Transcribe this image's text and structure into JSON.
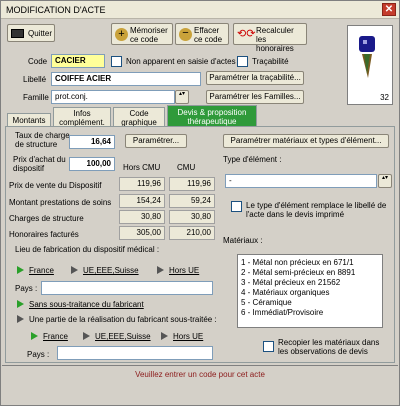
{
  "window": {
    "title": "MODIFICATION D'ACTE"
  },
  "toolbar": {
    "quit": "Quitter",
    "memorize": "Mémoriser ce code",
    "erase": "Effacer ce code",
    "recalc": "Recalculer les honoraires"
  },
  "preview": {
    "number": "32"
  },
  "form": {
    "code_label": "Code",
    "code_value": "CACIER",
    "non_apparent": "Non apparent en saisie d'actes",
    "tracabilite": "Traçabilité",
    "libelle_label": "Libellé",
    "libelle_value": "COIFFE ACIER",
    "param_tracabilite": "Paramétrer la traçabilité...",
    "famille_label": "Famille",
    "famille_value": "prot.conj.",
    "param_familles": "Paramétrer les Familles..."
  },
  "tabs": [
    {
      "label": "Montants"
    },
    {
      "label": "Infos complément."
    },
    {
      "label": "Code graphique"
    },
    {
      "label": "Devis & proposition thérapeutique"
    }
  ],
  "left": {
    "taux_label": "Taux de charge de structure",
    "taux_value": "16,64",
    "param_btn": "Paramétrer...",
    "prix_achat_label": "Prix d'achat du dispositif",
    "prix_achat_value": "100,00",
    "col_hors": "Hors CMU",
    "col_cmu": "CMU",
    "rows": [
      {
        "label": "Prix de vente du Dispositif",
        "hors": "119,96",
        "cmu": "119,96"
      },
      {
        "label": "Montant prestations de soins",
        "hors": "154,24",
        "cmu": "59,24"
      },
      {
        "label": "Charges de structure",
        "hors": "30,80",
        "cmu": "30,80"
      },
      {
        "label": "Honoraires facturés",
        "hors": "305,00",
        "cmu": "210,00"
      }
    ],
    "lieu_label": "Lieu de fabrication du dispositif médical :",
    "france": "France",
    "ue": "UE,EEE,Suisse",
    "hors_ue": "Hors UE",
    "pays_label": "Pays :",
    "sans_sous": "Sans sous-traitance du fabricant",
    "partie": "Une partie de la réalisation du fabricant sous-traitée :",
    "france2": "France",
    "ue2": "UE,EEE,Suisse",
    "hors_ue2": "Hors UE",
    "pays2_label": "Pays :"
  },
  "right": {
    "param_materiaux": "Paramétrer matériaux et types d'élément...",
    "type_label": "Type d'élément :",
    "type_value": "-",
    "remplace": "Le type d'élément remplace le libellé de l'acte dans le devis imprimé",
    "materiaux_label": "Matériaux :",
    "materiaux": [
      "1 - Métal non précieux en 671/1",
      "2 - Métal semi-précieux en 8891",
      "3 - Métal précieux en 21562",
      "4 - Matériaux organiques",
      "5 - Céramique",
      "6 - Immédiat/Provisoire"
    ],
    "recopier": "Recopier les matériaux dans les observations de devis"
  },
  "status": {
    "message": "Veuillez entrer un code pour cet acte"
  }
}
